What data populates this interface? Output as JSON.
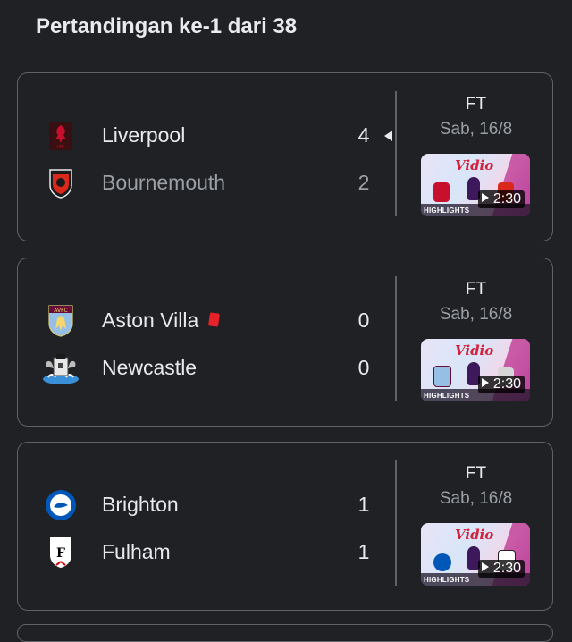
{
  "heading": "Pertandingan ke-1 dari 38",
  "matches": [
    {
      "home": {
        "name": "Liverpool",
        "score": "4",
        "logo": "liverpool-crest-icon",
        "winner": true
      },
      "away": {
        "name": "Bournemouth",
        "score": "2",
        "logo": "bournemouth-crest-icon",
        "winner": false
      },
      "status": "FT",
      "date": "Sab, 16/8",
      "video": {
        "brand": "Vidio",
        "badge": "HIGHLIGHTS",
        "duration": "2:30"
      }
    },
    {
      "home": {
        "name": "Aston Villa",
        "score": "0",
        "logo": "aston-villa-crest-icon",
        "red_card": true
      },
      "away": {
        "name": "Newcastle",
        "score": "0",
        "logo": "newcastle-crest-icon"
      },
      "status": "FT",
      "date": "Sab, 16/8",
      "video": {
        "brand": "Vidio",
        "badge": "HIGHLIGHTS",
        "duration": "2:30"
      }
    },
    {
      "home": {
        "name": "Brighton",
        "score": "1",
        "logo": "brighton-crest-icon"
      },
      "away": {
        "name": "Fulham",
        "score": "1",
        "logo": "fulham-crest-icon"
      },
      "status": "FT",
      "date": "Sab, 16/8",
      "video": {
        "brand": "Vidio",
        "badge": "HIGHLIGHTS",
        "duration": "2:30"
      }
    }
  ],
  "colors": {
    "background": "#202124",
    "card_border": "#5f6368",
    "text_primary": "#e8eaed",
    "text_secondary": "#9aa0a6",
    "red_card": "#e8202a",
    "vidio_red": "#d4213d"
  }
}
